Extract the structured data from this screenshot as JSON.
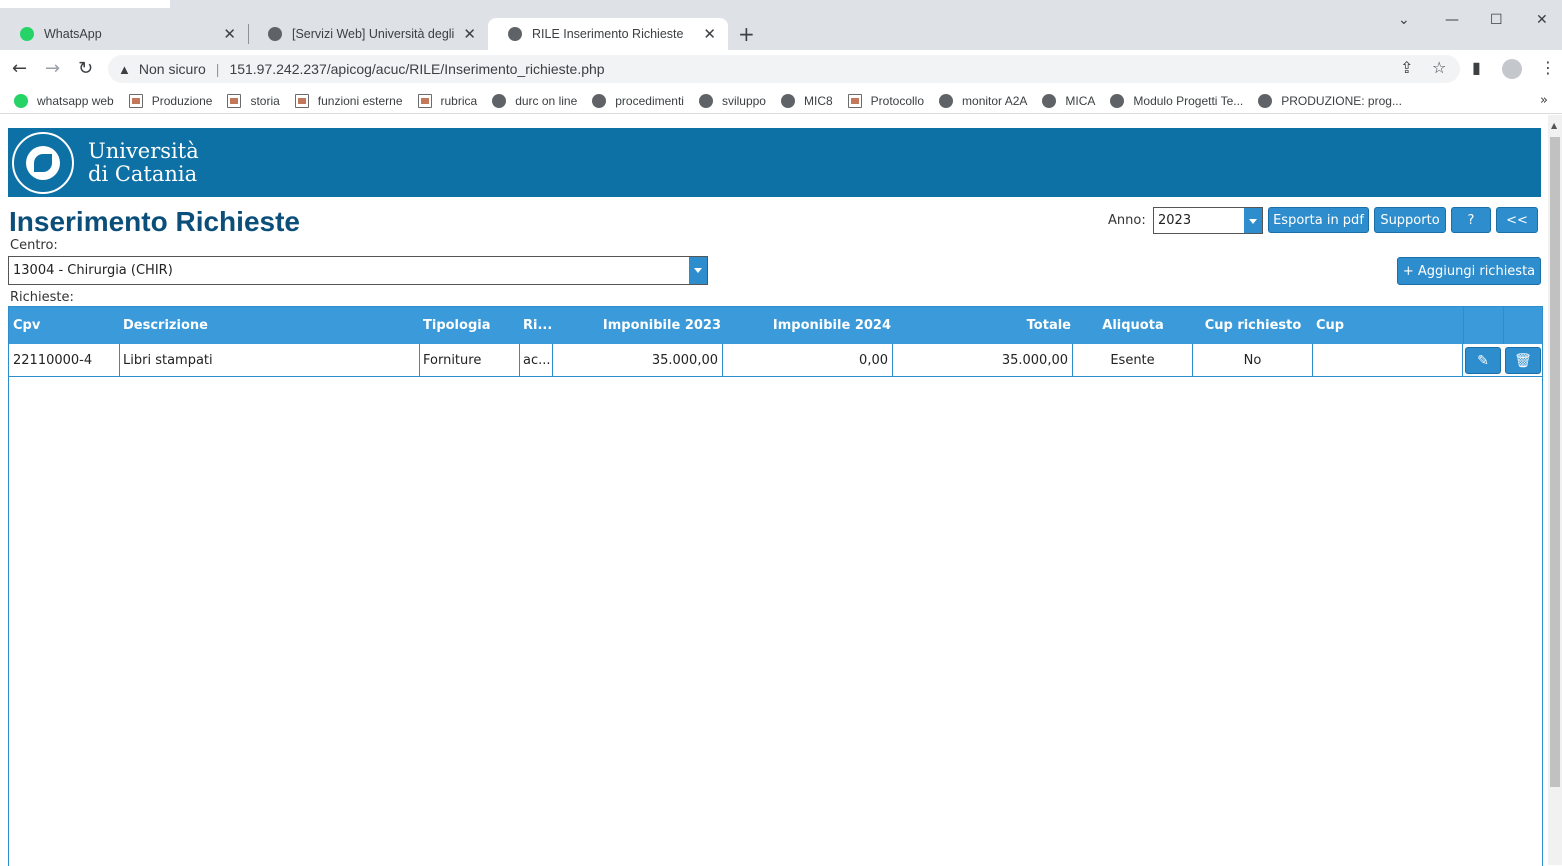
{
  "browser": {
    "tabs": [
      {
        "title": "WhatsApp",
        "active": false
      },
      {
        "title": "[Servizi Web] Università degli Stu",
        "active": false
      },
      {
        "title": "RILE Inserimento Richieste",
        "active": true
      }
    ],
    "security_label": "Non sicuro",
    "url": "151.97.242.237/apicog/acuc/RILE/Inserimento_richieste.php",
    "bookmarks": [
      {
        "label": "whatsapp web",
        "icon": "whatsapp-icon"
      },
      {
        "label": "Produzione",
        "icon": "image-icon"
      },
      {
        "label": "storia",
        "icon": "image-icon"
      },
      {
        "label": "funzioni esterne",
        "icon": "image-icon"
      },
      {
        "label": "rubrica",
        "icon": "image-icon"
      },
      {
        "label": "durc on line",
        "icon": "globe-icon"
      },
      {
        "label": "procedimenti",
        "icon": "globe-icon"
      },
      {
        "label": "sviluppo",
        "icon": "globe-icon"
      },
      {
        "label": "MIC8",
        "icon": "globe-icon"
      },
      {
        "label": "Protocollo",
        "icon": "image-icon"
      },
      {
        "label": "monitor A2A",
        "icon": "globe-icon"
      },
      {
        "label": "MICA",
        "icon": "globe-icon"
      },
      {
        "label": "Modulo Progetti Te...",
        "icon": "globe-icon"
      },
      {
        "label": "PRODUZIONE: prog...",
        "icon": "globe-icon"
      }
    ]
  },
  "header": {
    "university_line1": "Università",
    "university_line2": "di Catania",
    "brand_color": "#0e71a5"
  },
  "page": {
    "title": "Inserimento Richieste",
    "anno_label": "Anno:",
    "anno_value": "2023",
    "export_label": "Esporta in pdf",
    "support_label": "Supporto",
    "help_label": "?",
    "back_label": "<<",
    "centro_label": "Centro:",
    "centro_value": "13004 - Chirurgia (CHIR)",
    "add_label": "+ Aggiungi richiesta",
    "richieste_label": "Richieste:"
  },
  "table": {
    "columns": [
      "Cpv",
      "Descrizione",
      "Tipologia",
      "Ri...",
      "Imponibile 2023",
      "Imponibile 2024",
      "Totale",
      "Aliquota",
      "Cup richiesto",
      "Cup"
    ],
    "rows": [
      {
        "cpv": "22110000-4",
        "descrizione": "Libri stampati",
        "tipologia": "Forniture",
        "ri": "ac...",
        "imp2023": "35.000,00",
        "imp2024": "0,00",
        "totale": "35.000,00",
        "aliquota": "Esente",
        "cup_richiesto": "No",
        "cup": ""
      }
    ]
  }
}
